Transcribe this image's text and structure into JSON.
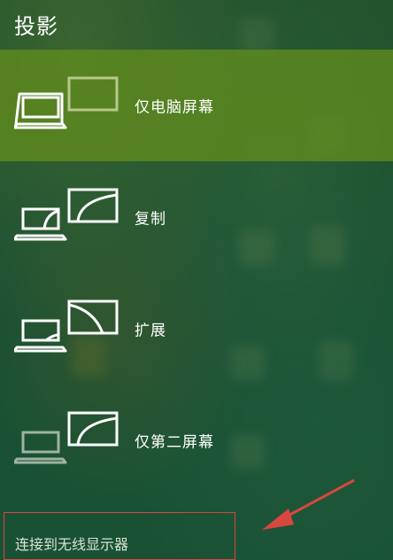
{
  "title": "投影",
  "options": [
    {
      "label": "仅电脑屏幕",
      "icon": "pc-screen-only-icon",
      "selected": true
    },
    {
      "label": "复制",
      "icon": "duplicate-icon",
      "selected": false
    },
    {
      "label": "扩展",
      "icon": "extend-icon",
      "selected": false
    },
    {
      "label": "仅第二屏幕",
      "icon": "second-screen-only-icon",
      "selected": false
    }
  ],
  "connect": {
    "label": "连接到无线显示器"
  },
  "colors": {
    "selected_bg": "#608c1e",
    "annotation": "#d9463e"
  }
}
